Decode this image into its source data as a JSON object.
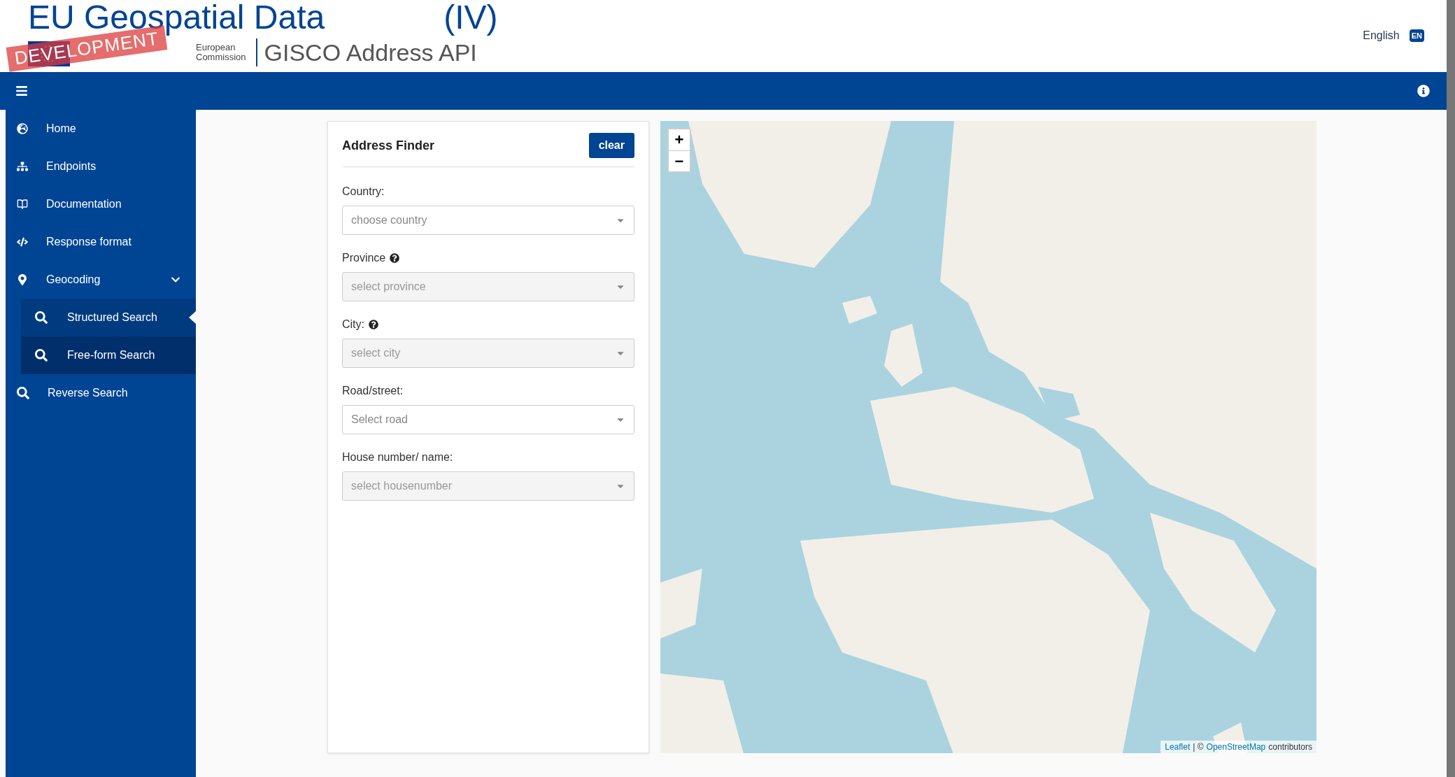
{
  "slide_title": {
    "text": "EU Geospatial Data",
    "suffix": "(IV)"
  },
  "header": {
    "stamp": "DEVELOPMENT",
    "logo_text": [
      "European",
      "Commission"
    ],
    "app_title": "GISCO Address API",
    "language": {
      "label": "English",
      "code": "EN"
    }
  },
  "sidebar": {
    "items": [
      {
        "label": "Home"
      },
      {
        "label": "Endpoints"
      },
      {
        "label": "Documentation"
      },
      {
        "label": "Response format"
      },
      {
        "label": "Geocoding",
        "expanded": true,
        "children": [
          {
            "label": "Structured Search",
            "selected": true,
            "hovered": false
          },
          {
            "label": "Free-form Search",
            "selected": false,
            "hovered": true
          }
        ]
      },
      {
        "label": "Reverse Search"
      }
    ]
  },
  "form": {
    "title": "Address Finder",
    "clear_button": "clear",
    "fields": [
      {
        "label": "Country:",
        "help": false,
        "placeholder": "choose country",
        "disabled": false
      },
      {
        "label": "Province",
        "help": true,
        "placeholder": "select province",
        "disabled": true
      },
      {
        "label": "City:",
        "help": true,
        "placeholder": "select city",
        "disabled": true
      },
      {
        "label": "Road/street:",
        "help": false,
        "placeholder": "Select road",
        "disabled": false
      },
      {
        "label": "House number/ name:",
        "help": false,
        "placeholder": "select housenumber",
        "disabled": true
      }
    ]
  },
  "map": {
    "kind": "picture",
    "zoom_in": "+",
    "zoom_out": "−",
    "attribution": [
      {
        "text": "Leaflet",
        "link": true
      },
      {
        "text": "| ©",
        "link": false
      },
      {
        "text": "OpenStreetMap",
        "link": true
      },
      {
        "text": "contributors",
        "link": false
      }
    ]
  }
}
